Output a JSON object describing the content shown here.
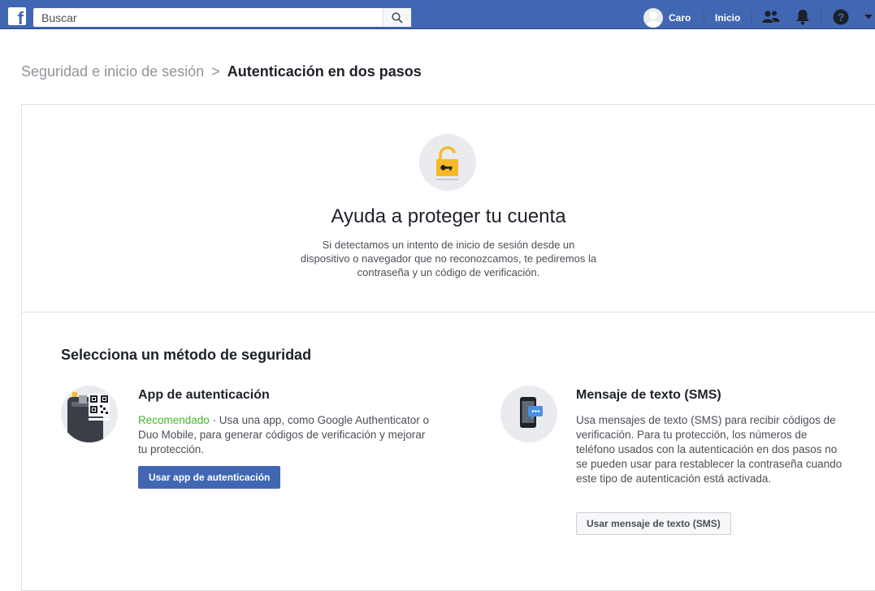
{
  "header": {
    "search_placeholder": "Buscar",
    "user_name": "Caro",
    "home_label": "Inicio",
    "icons": [
      "facebook-logo-icon",
      "search-icon",
      "friends-icon",
      "notifications-icon",
      "help-icon",
      "caret-down-icon"
    ]
  },
  "breadcrumb": {
    "parent": "Seguridad e inicio de sesión",
    "separator": ">",
    "current": "Autenticación en dos pasos"
  },
  "hero": {
    "title": "Ayuda a proteger tu cuenta",
    "description": "Si detectamos un intento de inicio de sesión desde un dispositivo o navegador que no reconozcamos, te pediremos la contraseña y un código de verificación."
  },
  "methods": {
    "section_title": "Selecciona un método de seguridad",
    "app": {
      "title": "App de autenticación",
      "recommended": "Recomendado",
      "description": " · Usa una app, como Google Authenticator o Duo Mobile, para generar códigos de verificación y mejorar tu protección.",
      "button": "Usar app de autenticación"
    },
    "sms": {
      "title": "Mensaje de texto (SMS)",
      "description": "Usa mensajes de texto (SMS) para recibir códigos de verificación. Para tu protección, los números de teléfono usados con la autenticación en dos pasos no se pueden usar para restablecer la contraseña cuando este tipo de autenticación está activada.",
      "button": "Usar mensaje de texto (SMS)"
    }
  },
  "colors": {
    "brand": "#4267b2",
    "recommended": "#42b72a",
    "lock": "#f7b928"
  }
}
